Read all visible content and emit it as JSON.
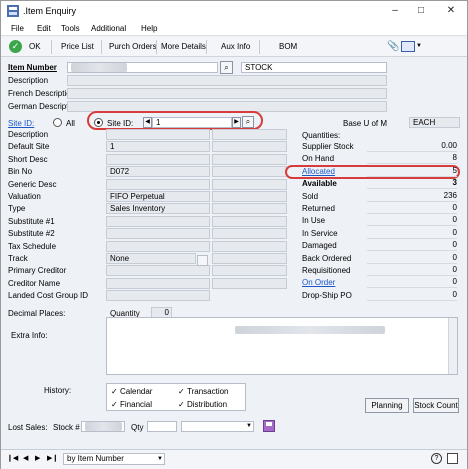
{
  "window": {
    "title": ".Item Enquiry"
  },
  "menu": [
    "File",
    "Edit",
    "Tools",
    "Additional",
    "Help"
  ],
  "toolbar": {
    "ok": "OK",
    "price_list": "Price List",
    "purch_orders": "Purch Orders",
    "more_details": "More Details",
    "aux_info": "Aux Info",
    "bom": "BOM"
  },
  "item": {
    "number_label": "Item Number",
    "type_value": "STOCK",
    "description_label": "Description",
    "french_label": "French Description",
    "german_label": "German Description"
  },
  "site": {
    "site_id_label": "Site ID:",
    "all_label": "All",
    "site_radio_label": "Site ID:",
    "site_value": "1",
    "base_uom_label": "Base U of M",
    "base_uom_value": "EACH"
  },
  "left_fields": [
    {
      "label": "Description",
      "value": ""
    },
    {
      "label": "Default Site",
      "value": "1"
    },
    {
      "label": "Short Desc",
      "value": ""
    },
    {
      "label": "Bin No",
      "value": "D072"
    },
    {
      "label": "Generic Desc",
      "value": ""
    },
    {
      "label": "Valuation",
      "value": "FIFO Perpetual"
    },
    {
      "label": "Type",
      "value": "Sales Inventory"
    },
    {
      "label": "Substitute #1",
      "value": ""
    },
    {
      "label": "Substitute #2",
      "value": ""
    },
    {
      "label": "Tax Schedule",
      "value": ""
    },
    {
      "label": "Track",
      "value": "None"
    },
    {
      "label": "Primary Creditor",
      "value": ""
    },
    {
      "label": "Creditor Name",
      "value": ""
    },
    {
      "label": "Landed Cost Group ID",
      "value": ""
    }
  ],
  "decimal": {
    "label": "Decimal Places:",
    "sublabel": "Quantity",
    "value": "0"
  },
  "quantities": {
    "title": "Quantities:",
    "rows": [
      {
        "label": "Supplier  Stock",
        "value": "0.00"
      },
      {
        "label": "On Hand",
        "value": "8"
      },
      {
        "label": "Allocated",
        "value": "5"
      },
      {
        "label": "Available",
        "value": "3"
      },
      {
        "label": "Sold",
        "value": "236"
      },
      {
        "label": "Returned",
        "value": "0"
      },
      {
        "label": "In Use",
        "value": "0"
      },
      {
        "label": "In Service",
        "value": "0"
      },
      {
        "label": "Damaged",
        "value": "0"
      },
      {
        "label": "Back Ordered",
        "value": "0"
      },
      {
        "label": "Requisitioned",
        "value": "0"
      },
      {
        "label": "On Order",
        "value": "0"
      },
      {
        "label": "Drop-Ship PO",
        "value": "0"
      }
    ]
  },
  "extra": {
    "label": "Extra Info:"
  },
  "history": {
    "label": "History:",
    "calendar": "Calendar",
    "transaction": "Transaction",
    "financial": "Financial",
    "distribution": "Distribution"
  },
  "buttons": {
    "planning": "Planning",
    "stock_count": "Stock Count"
  },
  "lost_sales": {
    "label": "Lost Sales:",
    "stock_label": "Stock #",
    "qty_label": "Qty"
  },
  "statusbar": {
    "sort": "by Item Number"
  },
  "colors": {
    "accent_red": "#d63c3c",
    "link_blue": "#1c57c9"
  }
}
